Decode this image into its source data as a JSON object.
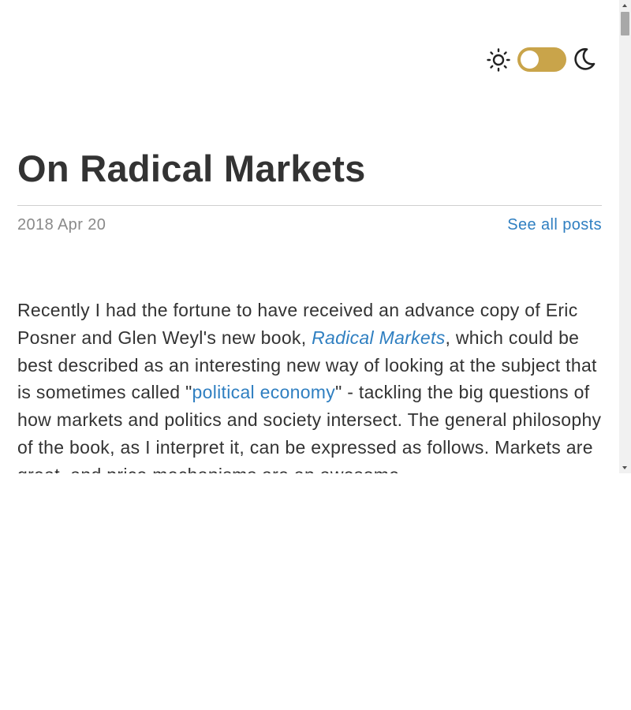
{
  "theme_toggle": {
    "light_icon": "sun-icon",
    "dark_icon": "moon-icon",
    "state": "light",
    "accent_color": "#c9a44a"
  },
  "post": {
    "title": "On Radical Markets",
    "date": "2018 Apr 20",
    "see_all_label": "See all posts",
    "body": {
      "p1_a": "Recently I had the fortune to have received an advance copy of Eric Posner and Glen Weyl's new book, ",
      "book_title": "Radical Markets",
      "p1_b": ", which could be best described as an interesting new way of looking at the subject that is sometimes called \"",
      "link_text": "political economy",
      "p1_c": "\" - tackling the big questions of how markets and politics and society intersect. The general philosophy of the book, as I interpret it, can be expressed as follows. Markets are great, and price mechanisms are an awesome"
    }
  },
  "colors": {
    "link": "#2f7fc1",
    "text": "#333333",
    "muted": "#8a8a8a"
  }
}
